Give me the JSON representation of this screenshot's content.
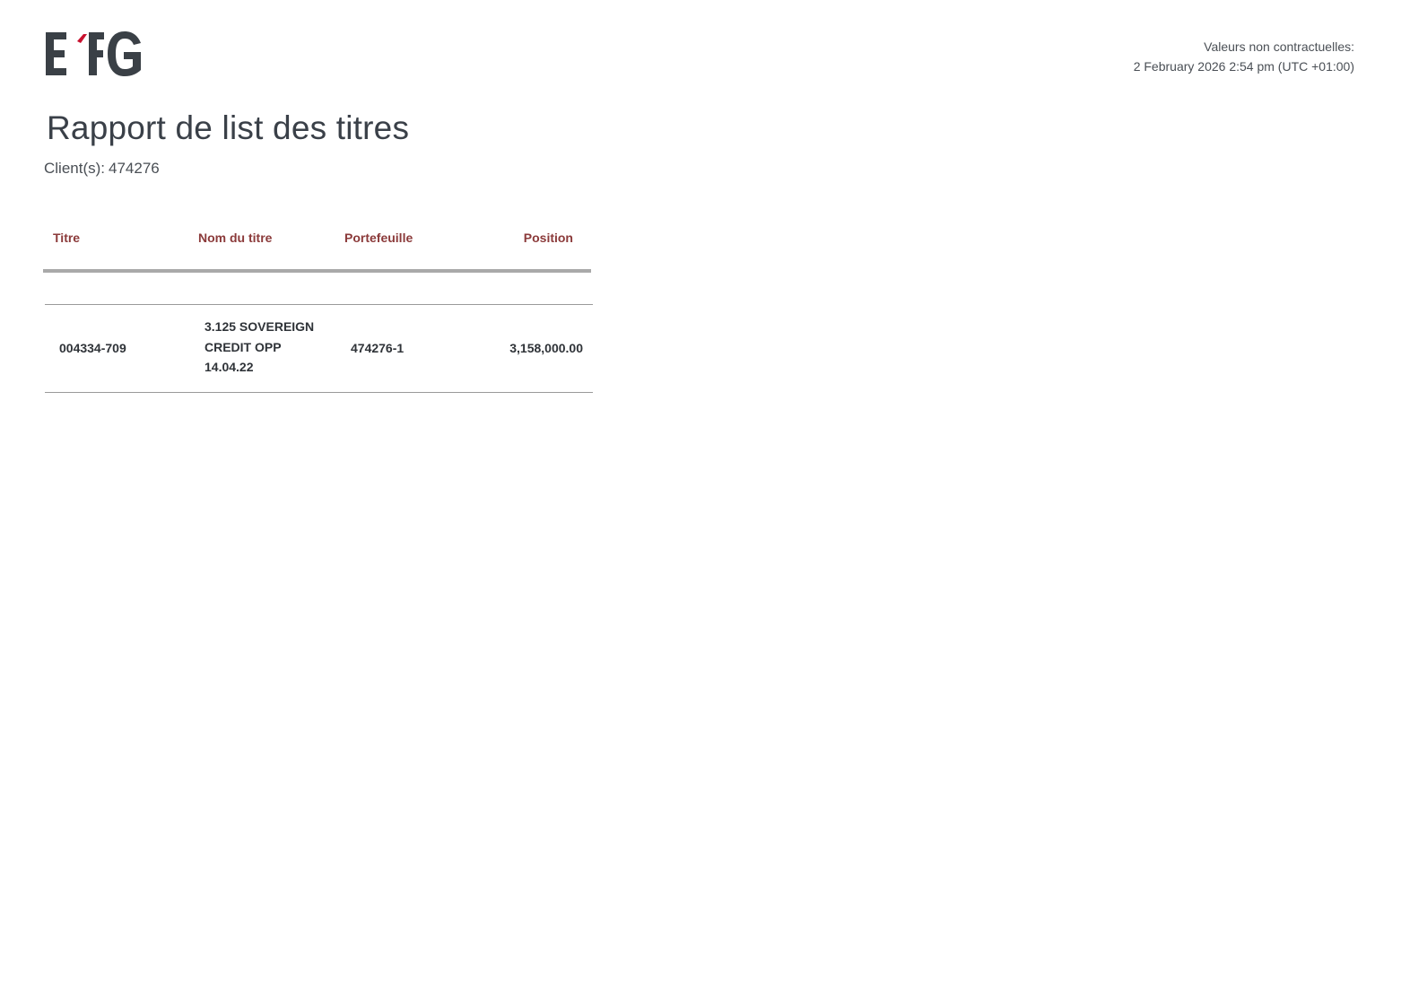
{
  "brand": {
    "name": "EFG",
    "dark_color": "#3a4046",
    "accent_color": "#c8102e"
  },
  "header": {
    "disclaimer": "Valeurs non contractuelles:",
    "timestamp": "2 February 2026 2:54 pm (UTC +01:00)"
  },
  "report": {
    "title": "Rapport de list des titres",
    "client_label": "Client(s):",
    "client_value": "474276"
  },
  "table": {
    "header_color": "#8b3a3a",
    "columns": [
      "Titre",
      "Nom du titre",
      "Portefeuille",
      "Position"
    ],
    "rows": [
      {
        "titre": "004334-709",
        "nom_du_titre": [
          "3.125 SOVEREIGN",
          "CREDIT OPP",
          "14.04.22"
        ],
        "portefeuille": "474276-1",
        "position": "3,158,000.00"
      }
    ]
  }
}
